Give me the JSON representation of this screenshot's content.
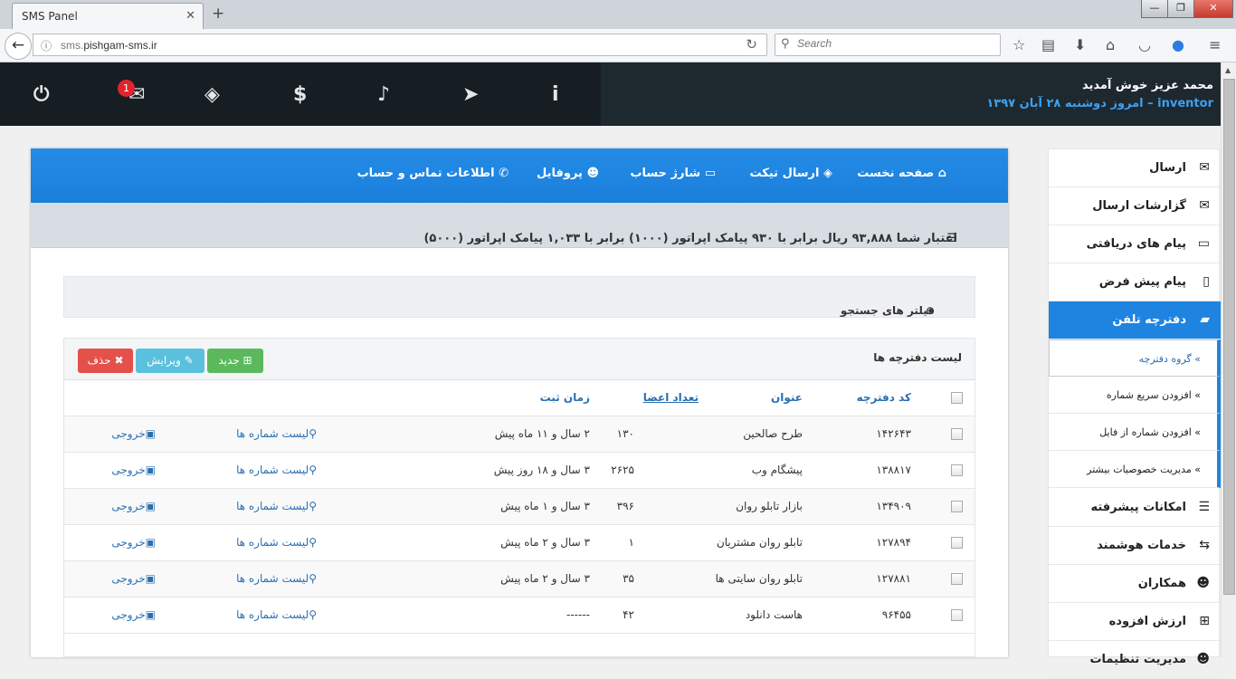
{
  "browser": {
    "tab_title": "SMS Panel",
    "tab_close": "✕",
    "new_tab": "+",
    "url_prefix": "sms.",
    "url_domain": "pishgam-sms.ir",
    "search_placeholder": "Search",
    "window_buttons": [
      "—",
      "❐",
      "✕"
    ]
  },
  "header": {
    "welcome": "محمد عزیز خوش آمدید",
    "user": "inventor",
    "date": " – امروز دوشنبه ۲۸ آبان ۱۳۹۷",
    "badge_count": "1",
    "icons": [
      "power-icon",
      "envelope-icon",
      "ticket-icon",
      "dollar-icon",
      "bell-icon",
      "paper-plane-icon",
      "info-icon"
    ]
  },
  "topnav": {
    "home": "صفحه نخست",
    "ticket": "ارسال تیکت",
    "charge": "شارژ حساب",
    "profile": "پروفایل",
    "contact": "اطلاعات تماس و حساب"
  },
  "credit": "اعتبار شما ۹۳,۸۸۸ ریال برابر با ۹۳۰ پیامک اپراتور (۱۰۰۰) برابر با ۱,۰۳۳ پیامک اپراتور (۵۰۰۰)",
  "filters": "فیلتر های جستجو",
  "list": {
    "title": "لیست دفترچه ها",
    "buttons": {
      "new": "جدید",
      "edit": "ویرایش",
      "delete": "حذف"
    },
    "columns": {
      "code": "کد دفترچه",
      "title": "عنوان",
      "members": "تعداد اعضا",
      "time": "زمان ثبت"
    },
    "members_link": "لیست شماره ها",
    "export_link": "خروجی",
    "rows": [
      {
        "code": "۱۴۲۶۴۳",
        "title": "طرح صالحین",
        "members": "۱۳۰",
        "time": "۲ سال و ۱۱ ماه پیش"
      },
      {
        "code": "۱۳۸۸۱۷",
        "title": "پیشگام وب",
        "members": "۲۶۲۵",
        "time": "۳ سال و ۱۸ روز پیش"
      },
      {
        "code": "۱۳۴۹۰۹",
        "title": "بازار تابلو روان",
        "members": "۳۹۶",
        "time": "۳ سال و ۱ ماه پیش"
      },
      {
        "code": "۱۲۷۸۹۴",
        "title": "تابلو روان مشتریان",
        "members": "۱",
        "time": "۳ سال و ۲ ماه پیش"
      },
      {
        "code": "۱۲۷۸۸۱",
        "title": "تابلو روان سایتی ها",
        "members": "۳۵",
        "time": "۳ سال و ۲ ماه پیش"
      },
      {
        "code": "۹۶۴۵۵",
        "title": "هاست دانلود",
        "members": "۴۲",
        "time": "------"
      }
    ]
  },
  "sidebar": {
    "items": [
      {
        "label": "ارسال",
        "icon": "envelope-icon"
      },
      {
        "label": "گزارشات ارسال",
        "icon": "envelope-open-icon"
      },
      {
        "label": "پیام های دریافتی",
        "icon": "inbox-icon"
      },
      {
        "label": "پیام پیش فرض",
        "icon": "file-icon"
      },
      {
        "label": "دفترچه تلفن",
        "icon": "book-icon"
      }
    ],
    "subitems": [
      "گروه دفترچه",
      "افزودن سریع شماره",
      "افزودن شماره از فایل",
      "مدیریت خصوصیات بیشتر"
    ],
    "more_items": [
      {
        "label": "امکانات پیشرفته",
        "icon": "list-icon"
      },
      {
        "label": "خدمات هوشمند",
        "icon": "retweet-icon"
      },
      {
        "label": "همکاران",
        "icon": "users-icon"
      },
      {
        "label": "ارزش افزوده",
        "icon": "plus-square-icon"
      },
      {
        "label": "مدیریت تنظیمات",
        "icon": "users-icon"
      }
    ]
  }
}
